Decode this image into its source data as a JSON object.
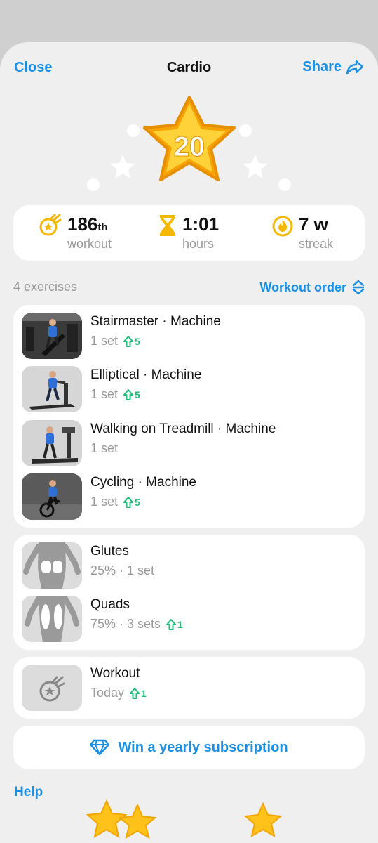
{
  "header": {
    "close": "Close",
    "title": "Cardio",
    "share": "Share"
  },
  "badge": {
    "number": "20"
  },
  "stats": {
    "workout_num": "186",
    "workout_suffix": "th",
    "workout_label": "workout",
    "hours_val": "1:01",
    "hours_label": "hours",
    "streak_val": "7 w",
    "streak_label": "streak"
  },
  "exercises_section": {
    "count": "4 exercises",
    "order": "Workout order"
  },
  "exercises": [
    {
      "name": "Stairmaster · Machine",
      "sets": "1 set",
      "pr": "5"
    },
    {
      "name": "Elliptical · Machine",
      "sets": "1 set",
      "pr": "5"
    },
    {
      "name": "Walking on Treadmill · Machine",
      "sets": "1 set"
    },
    {
      "name": "Cycling · Machine",
      "sets": "1 set",
      "pr": "5"
    }
  ],
  "muscles": [
    {
      "name": "Glutes",
      "detail": "25% · 1 set"
    },
    {
      "name": "Quads",
      "detail": "75% · 3 sets",
      "pr": "1"
    }
  ],
  "workout_card": {
    "name": "Workout",
    "when": "Today",
    "pr": "1"
  },
  "promo": {
    "label": "Win a yearly subscription"
  },
  "help": "Help",
  "colors": {
    "accent": "#1a8fe3",
    "gold": "#f5b800",
    "pr_green": "#1fbf7a"
  }
}
